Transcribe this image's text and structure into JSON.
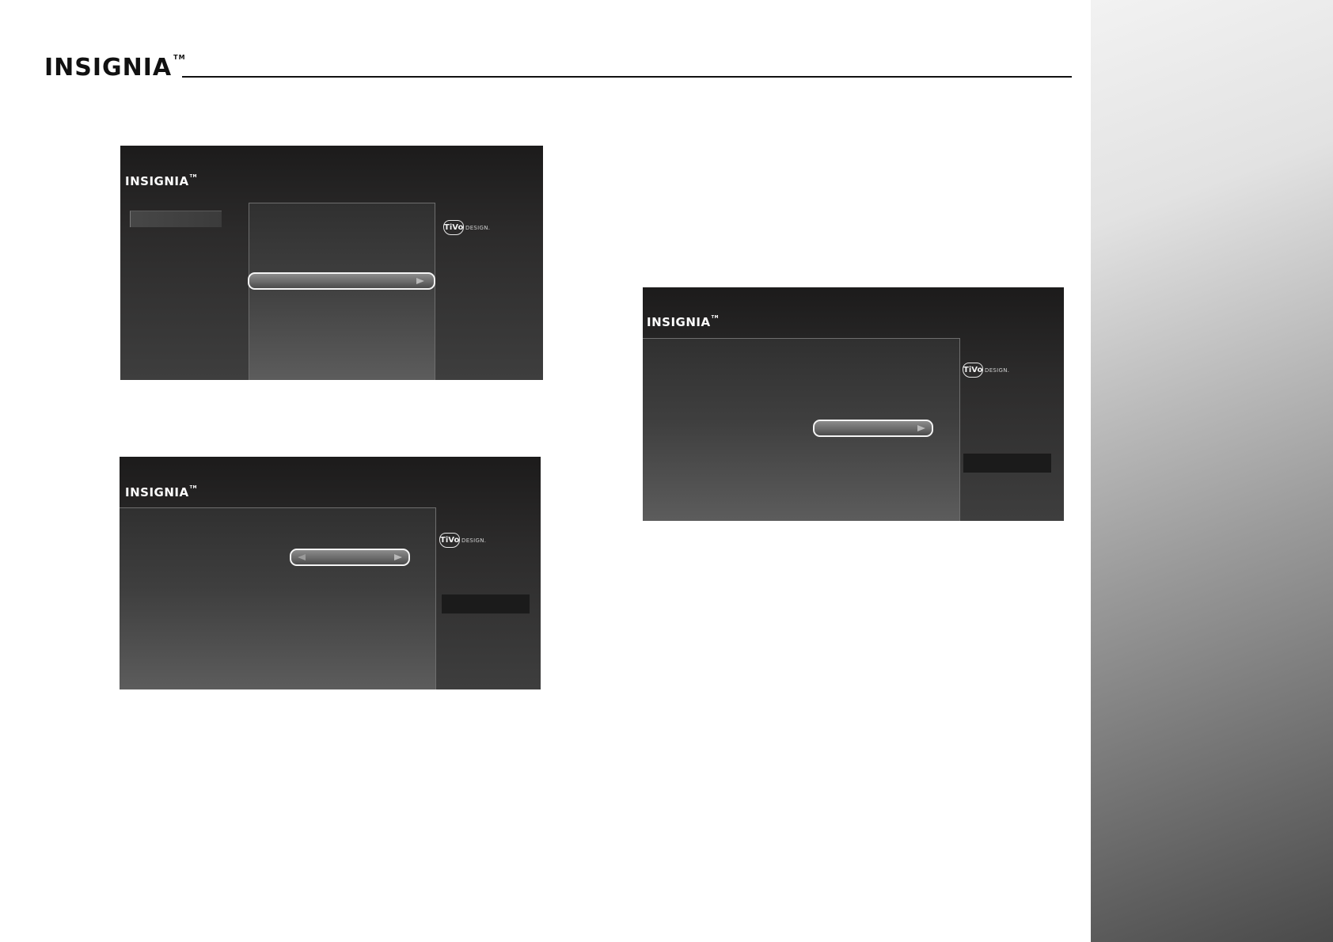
{
  "header": {
    "brand": "INSIGNIA",
    "trademark": "TM"
  },
  "screens": {
    "top_left": {
      "logo": "INSIGNIA",
      "tivo_badge": "TiVo",
      "tivo_text": "DESIGN."
    },
    "bottom_left": {
      "logo": "INSIGNIA",
      "tivo_badge": "TiVo",
      "tivo_text": "DESIGN."
    },
    "right": {
      "logo": "INSIGNIA",
      "tivo_badge": "TiVo",
      "tivo_text": "DESIGN."
    }
  }
}
